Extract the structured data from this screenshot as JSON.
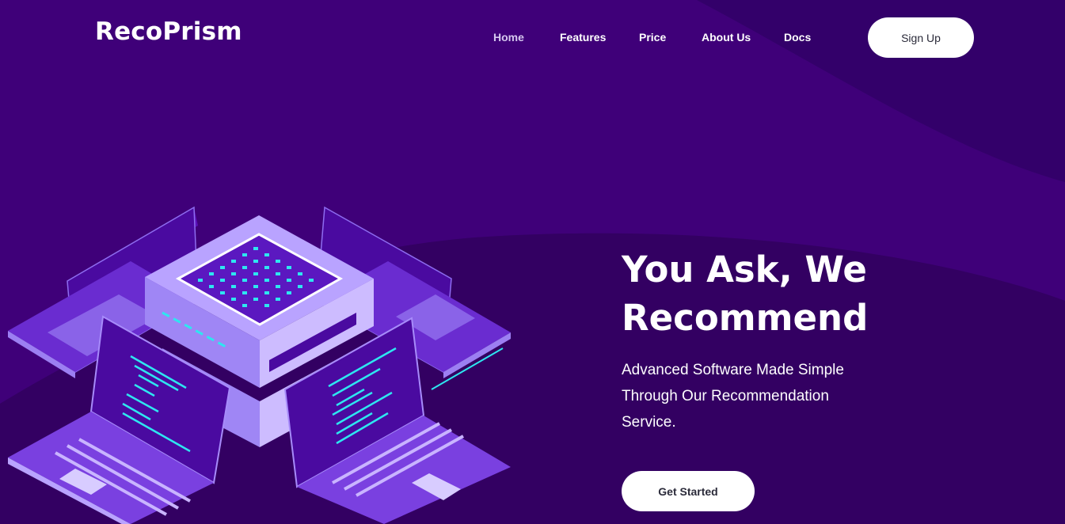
{
  "brand": {
    "name": "RecoPrism"
  },
  "nav": {
    "items": [
      {
        "label": "Home",
        "active": true
      },
      {
        "label": "Features",
        "active": false
      },
      {
        "label": "Price",
        "active": false
      },
      {
        "label": "About Us",
        "active": false
      },
      {
        "label": "Docs",
        "active": false
      }
    ],
    "signup_label": "Sign Up"
  },
  "hero": {
    "title_line1": "You Ask, We",
    "title_line2": "Recommend",
    "subtitle_line1": "Advanced Software Made Simple",
    "subtitle_line2": "Through Our Recommendation",
    "subtitle_line3": "Service.",
    "cta_label": "Get Started"
  },
  "colors": {
    "background": "#3a0070",
    "accent_light": "#c9b4ff",
    "accent_cyan": "#2ee6f0",
    "button_bg": "#ffffff"
  },
  "illustration": {
    "icon": "server-with-laptops-illustration"
  }
}
